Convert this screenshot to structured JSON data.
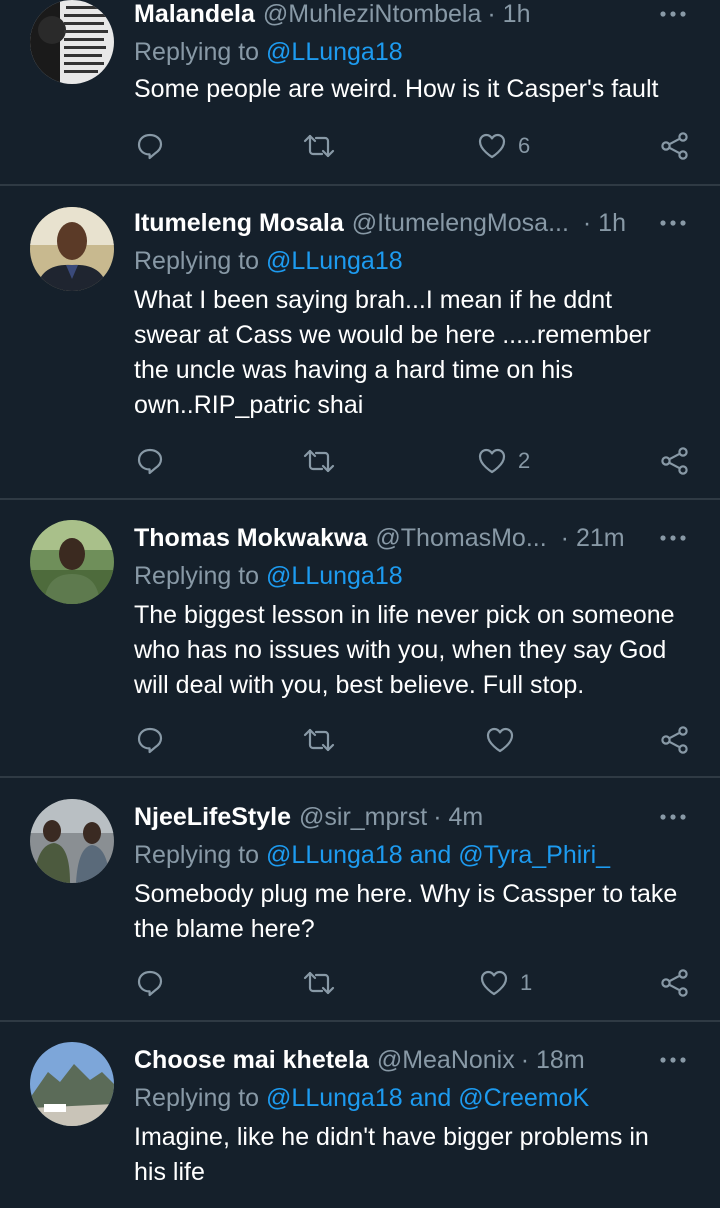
{
  "colors": {
    "background": "#15202b",
    "text": "#ffffff",
    "muted": "#8899a6",
    "accent": "#1d9bf0",
    "divider": "#2f3a44"
  },
  "icons": {
    "reply": "reply-icon",
    "retweet": "retweet-icon",
    "like": "heart-icon",
    "share": "share-icon",
    "more": "more-icon"
  },
  "tweets": [
    {
      "name": "Malandela",
      "handle": "@MuhleziNtombela",
      "time": "· 1h",
      "replying_prefix": "Replying to",
      "mentions": "@LLunga18",
      "text": "Some people are weird. How is it Casper's fault",
      "likes": "6"
    },
    {
      "name": "Itumeleng Mosala",
      "handle": "@ItumelengMosa...",
      "time": "· 1h",
      "replying_prefix": "Replying to",
      "mentions": "@LLunga18",
      "text_lines": [
        "What I been saying brah...I mean if he ddnt",
        "swear at Cass we  would be here .....remember",
        "the uncle was having a hard time on his",
        "own..RIP_patric shai"
      ],
      "likes": "2"
    },
    {
      "name": "Thomas Mokwakwa",
      "handle": "@ThomasMo...",
      "time": "· 21m",
      "replying_prefix": "Replying to",
      "mentions": "@LLunga18",
      "text_lines": [
        "The biggest lesson in life never pick on someone",
        "who has no issues with you, when they  say God",
        "will deal with you, best believe. Full stop."
      ],
      "likes": ""
    },
    {
      "name": "NjeeLifeStyle",
      "handle": "@sir_mprst",
      "time": "· 4m",
      "replying_prefix": "Replying to",
      "mentions": "@LLunga18 and @Tyra_Phiri_",
      "text_lines": [
        "Somebody plug me here. Why is Cassper to take",
        "the blame here?"
      ],
      "likes": "1"
    },
    {
      "name": "Choose mai khetela",
      "handle": "@MeaNonix",
      "time": "· 18m",
      "replying_prefix": "Replying to",
      "mentions": "@LLunga18 and @CreemoK",
      "text_lines": [
        "Imagine, like he didn't have bigger problems in",
        "his life"
      ]
    }
  ]
}
